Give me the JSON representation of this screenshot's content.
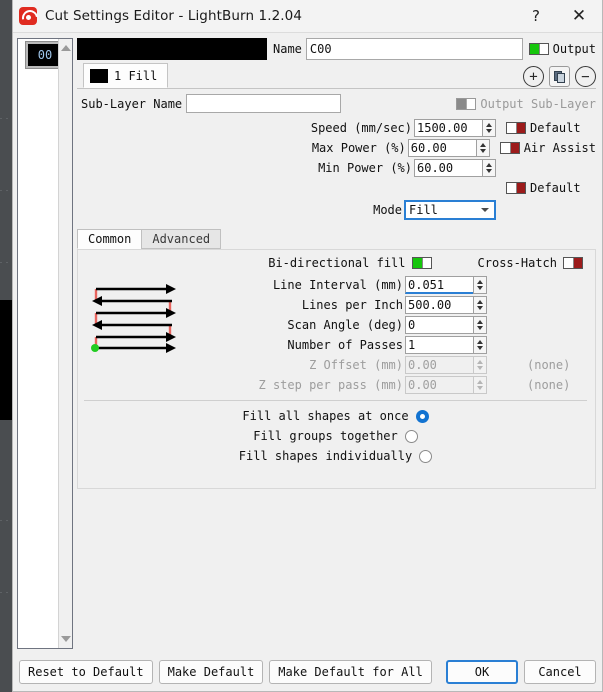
{
  "window": {
    "title": "Cut Settings Editor - LightBurn 1.2.04",
    "logo_icon": "lightburn-logo-icon",
    "help_label": "?",
    "close_label": "✕"
  },
  "layer_list": {
    "items": [
      {
        "label": "00",
        "color": "#000000",
        "selected": true
      }
    ],
    "scroll_up_icon": "triangle-up-icon",
    "scroll_down_icon": "triangle-down-icon"
  },
  "header": {
    "color_swatch": "#000000",
    "name_label": "Name",
    "name_value": "C00",
    "output_label": "Output",
    "output_on": true,
    "layer_tab_label": "1 Fill",
    "add_icon": "plus-circle-icon",
    "duplicate_icon": "copy-icon",
    "remove_icon": "minus-circle-icon",
    "sub_layer_name_label": "Sub-Layer Name",
    "sub_layer_name_value": "",
    "output_sub_layer_label": "Output Sub-Layer",
    "output_sub_layer_enabled": false
  },
  "settings": {
    "speed_label": "Speed (mm/sec)",
    "speed_value": "1500.00",
    "speed_default_label": "Default",
    "max_power_label": "Max Power (%)",
    "max_power_value": "60.00",
    "air_assist_label": "Air Assist",
    "min_power_label": "Min Power (%)",
    "min_power_value": "60.00",
    "power_default_label": "Default",
    "mode_label": "Mode",
    "mode_value": "Fill",
    "chevron_icon": "chevron-down-icon"
  },
  "tabs": {
    "common_label": "Common",
    "advanced_label": "Advanced",
    "active": "Common"
  },
  "common": {
    "bidirectional_label": "Bi-directional fill",
    "bidirectional_on": true,
    "cross_hatch_label": "Cross-Hatch",
    "cross_hatch_on": false,
    "line_interval_label": "Line Interval (mm)",
    "line_interval_value": "0.051",
    "lines_per_inch_label": "Lines per Inch",
    "lines_per_inch_value": "500.00",
    "scan_angle_label": "Scan Angle (deg)",
    "scan_angle_value": "0",
    "passes_label": "Number of Passes",
    "passes_value": "1",
    "z_offset_label": "Z Offset (mm)",
    "z_offset_value": "0.00",
    "z_offset_trailing": "(none)",
    "z_step_label": "Z step per pass (mm)",
    "z_step_value": "0.00",
    "z_step_trailing": "(none)",
    "fill_all_label": "Fill all shapes at once",
    "fill_groups_label": "Fill groups together",
    "fill_individually_label": "Fill shapes individually",
    "fill_selected": "Fill all shapes at once",
    "diagram_icon": "fill-pattern-diagram-icon"
  },
  "footer": {
    "reset_to_default": "Reset to Default",
    "make_default": "Make Default",
    "make_default_for_all": "Make Default for All",
    "ok": "OK",
    "cancel": "Cancel"
  },
  "colors": {
    "toggle_on": "#16c60c",
    "toggle_off": "#9c1b1b",
    "focus_blue": "#2a7fd4",
    "radio_blue": "#1273d1",
    "diagram_line": "#000000",
    "diagram_connector": "#e8655f",
    "diagram_start": "#22cc22"
  }
}
